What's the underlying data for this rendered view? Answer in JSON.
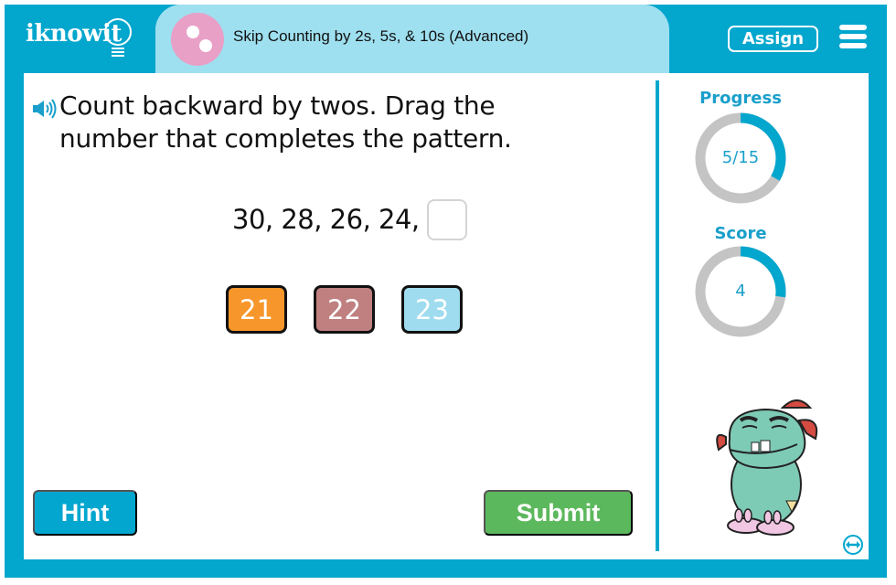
{
  "header": {
    "logo_text": "iknowit",
    "lesson_title": "Skip Counting by 2s, 5s, & 10s (Advanced)",
    "assign_label": "Assign",
    "menu_icon": "hamburger-menu-icon"
  },
  "question": {
    "audio_icon": "speaker-icon",
    "prompt": "Count backward by twos. Drag the number that completes the pattern.",
    "prompt_line1": "Count backward by twos. Drag the",
    "prompt_line2": "number that completes the pattern.",
    "sequence": "30, 28, 26, 24,",
    "answer_slot": ""
  },
  "choices": [
    {
      "label": "21",
      "color": "#f7962b"
    },
    {
      "label": "22",
      "color": "#c08080"
    },
    {
      "label": "23",
      "color": "#9fdcef"
    }
  ],
  "buttons": {
    "hint_label": "Hint",
    "submit_label": "Submit"
  },
  "sidebar": {
    "progress_label": "Progress",
    "progress_value": "5/15",
    "progress_fraction": 0.3333,
    "score_label": "Score",
    "score_value": "4",
    "score_fraction": 0.27,
    "mascot": "monster-mascot",
    "expand_icon": "expand-arrows-icon"
  },
  "colors": {
    "brand_blue": "#03a6cd",
    "title_bar": "#9fe0f0",
    "ring_track": "#c4c4c4",
    "ring_fill": "#03a6cd",
    "hint": "#02a6cf",
    "submit": "#5cb85c"
  }
}
